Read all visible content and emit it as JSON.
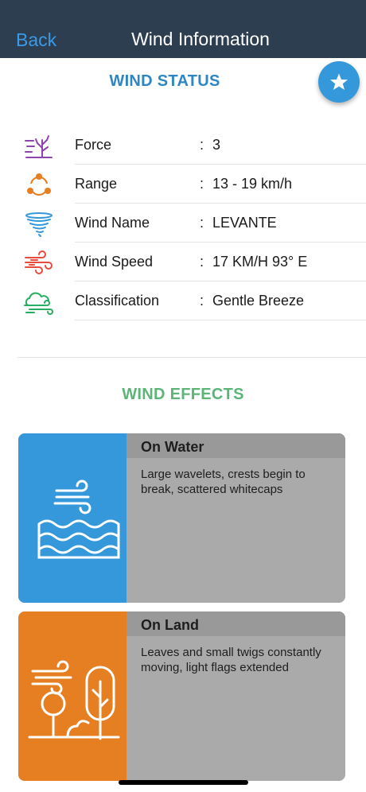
{
  "navbar": {
    "back_label": "Back",
    "title": "Wind Information"
  },
  "fab": {
    "icon": "star-icon"
  },
  "status": {
    "title": "WIND STATUS",
    "rows": [
      {
        "label": "Force",
        "colon": ":",
        "value": "3",
        "icon": "tree-wind-icon",
        "color": "#8e44ad"
      },
      {
        "label": "Range",
        "colon": ":",
        "value": "13 - 19  km/h",
        "icon": "cycle-icon",
        "color": "#e67e22"
      },
      {
        "label": "Wind Name",
        "colon": ":",
        "value": "LEVANTE",
        "icon": "tornado-icon",
        "color": "#3498db"
      },
      {
        "label": "Wind Speed",
        "colon": ":",
        "value": "17 KM/H 93° E",
        "icon": "wind-speed-icon",
        "color": "#e74c3c"
      },
      {
        "label": "Classification",
        "colon": ":",
        "value": "Gentle Breeze",
        "icon": "cloud-wind-icon",
        "color": "#27ae60"
      }
    ]
  },
  "effects": {
    "title": "WIND EFFECTS",
    "cards": [
      {
        "heading": "On Water",
        "text": "Large wavelets, crests begin to break, scattered whitecaps",
        "icon": "wind-waves-icon",
        "color": "#3498db"
      },
      {
        "heading": "On Land",
        "text": "Leaves and small twigs constantly moving, light flags extended",
        "icon": "wind-trees-icon",
        "color": "#e67e22"
      }
    ]
  }
}
